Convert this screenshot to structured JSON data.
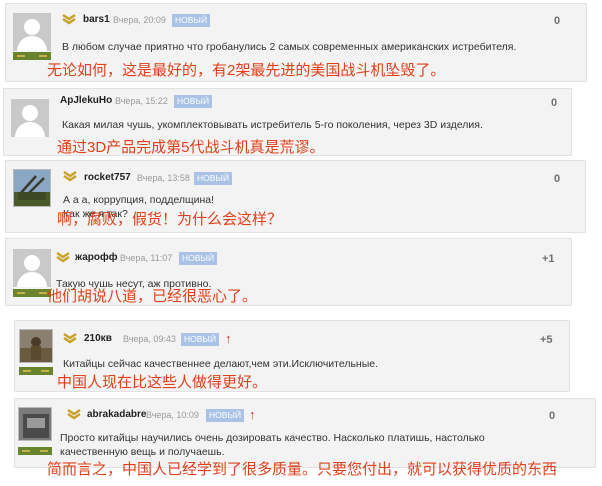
{
  "comments": [
    {
      "username": "bars1",
      "time": "Вчера, 20:09",
      "badge": "НОВЫЙ",
      "score": "0",
      "text": "В любом случае приятно что гробанулись 2 самых современных американских истребителя.",
      "translation": "无论如何，这是最好的，有2架最先进的美国战斗机坠毁了。"
    },
    {
      "username": "ApJlekuHo",
      "time": "Вчера, 15:22",
      "badge": "НОВЫЙ",
      "score": "0",
      "text": "Какая милая чушь, укомплектовывать истребитель 5-го поколения, через 3D изделия.",
      "translation": "通过3D产品完成第5代战斗机真是荒谬。"
    },
    {
      "username": "rocket757",
      "time": "Вчера, 13:58",
      "badge": "НОВЫЙ",
      "score": "0",
      "text": "А а а, коррупция, подделщина!",
      "text2": "Как же я так?",
      "translation": "啊，腐败，假货！为什么会这样？"
    },
    {
      "username": "жарофф",
      "time": "Вчера, 11:07",
      "badge": "НОВЫЙ",
      "score": "+1",
      "text": "Такую чушь несут, аж противно.",
      "translation": "他们胡说八道，已经很恶心了。"
    },
    {
      "username": "210кв",
      "time": "Вчера, 09:43",
      "badge": "НОВЫЙ",
      "score": "+5",
      "text": "Китайцы сейчас качественнее делают,чем эти.Исключительные.",
      "translation": "中国人现在比这些人做得更好。"
    },
    {
      "username": "abrakadabre",
      "time": "Вчера, 10:09",
      "badge": "НОВЫЙ",
      "score": "0",
      "text": "Просто китайцы научились очень дозировать качество. Насколько платишь, настолько качественную вещь и получаешь.",
      "translation": "简而言之，中国人已经学到了很多质量。只要您付出，就可以获得优质的东西"
    }
  ],
  "icons": {
    "rank": "sergeant-chevron-icon",
    "upvote": "red-up-arrow-icon",
    "avatar": "default-user-avatar"
  },
  "colors": {
    "translation": "#e23f1a",
    "badge": "#a9c2e5",
    "card": "#f3f3f3",
    "upvote": "#c63a2a"
  }
}
